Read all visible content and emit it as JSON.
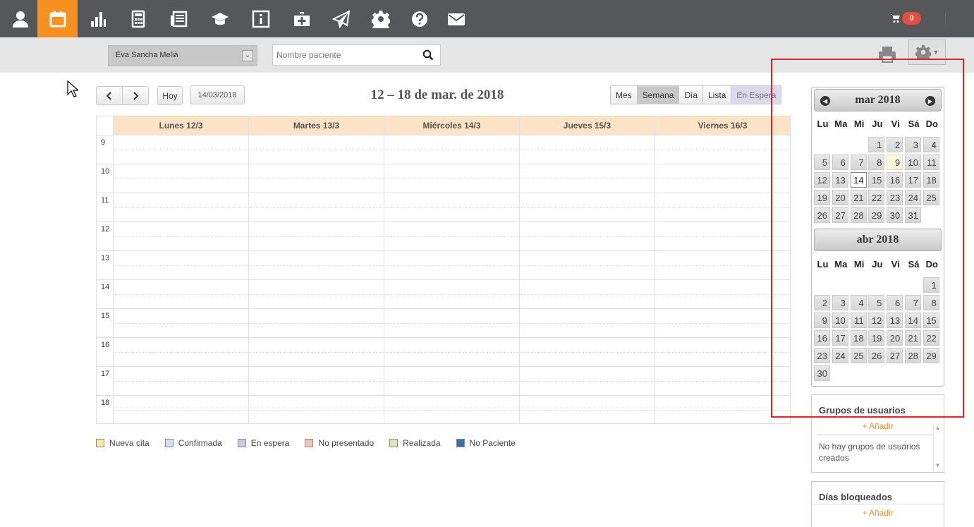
{
  "nav": {
    "icons": [
      "user-icon",
      "calendar-icon",
      "bar-chart-icon",
      "calculator-icon",
      "newspaper-icon",
      "graduation-cap-icon",
      "info-icon",
      "first-aid-kit-icon",
      "paper-plane-icon",
      "gear-icon",
      "question-icon",
      "envelope-icon"
    ],
    "active": "calendar-icon",
    "active_color": "#f7901e",
    "cart_count": "0"
  },
  "subbar": {
    "user_select_value": "Eva Sancha Melià",
    "search_placeholder": "Nombre paciente"
  },
  "toolbar": {
    "prev_label": "<",
    "next_label": ">",
    "today_label": "Hoy",
    "date_value": "14/03/2018",
    "title": "12 – 18 de mar. de 2018",
    "views": [
      "Mes",
      "Semana",
      "Día",
      "Lista",
      "En Espera"
    ],
    "active_view": "Semana"
  },
  "week": {
    "days": [
      "Lunes 12/3",
      "Martes 13/3",
      "Miércoles 14/3",
      "Jueves 15/3",
      "Viernes 16/3"
    ],
    "hours": [
      "9",
      "10",
      "11",
      "12",
      "13",
      "14",
      "15",
      "16",
      "17",
      "18"
    ]
  },
  "legend": [
    {
      "label": "Nueva cita",
      "color": "#fbe9a4"
    },
    {
      "label": "Confirmada",
      "color": "#cfe0f4"
    },
    {
      "label": "En espera",
      "color": "#c9c8e6"
    },
    {
      "label": "No presentado",
      "color": "#f6c2b5"
    },
    {
      "label": "Realizada",
      "color": "#d4e9b4"
    },
    {
      "label": "No Paciente",
      "color": "#3f6fa8"
    }
  ],
  "minical": {
    "dow": [
      "Lu",
      "Ma",
      "Mi",
      "Ju",
      "Vi",
      "Sá",
      "Do"
    ],
    "months": [
      {
        "title": "mar 2018",
        "first_weekday": 3,
        "days": 31,
        "today": 14,
        "highlight": 9
      },
      {
        "title": "abr 2018",
        "first_weekday": 6,
        "days": 30
      }
    ]
  },
  "panels": {
    "groups": {
      "title": "Grupos de usuarios",
      "add_label": "Añadir",
      "empty_text": "No hay grupos de usuarios creados"
    },
    "blocked": {
      "title": "Días bloqueados",
      "add_label": "Añadir"
    }
  }
}
